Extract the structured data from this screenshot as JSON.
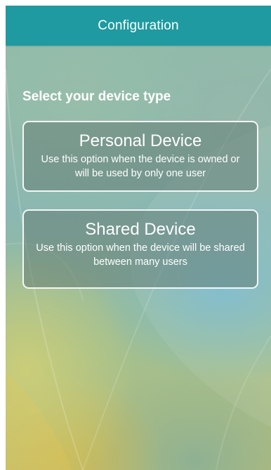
{
  "header": {
    "title": "Configuration"
  },
  "main": {
    "subtitle": "Select your device type",
    "options": [
      {
        "title": "Personal Device",
        "description": "Use this option when the device is owned or will be used by only one user"
      },
      {
        "title": "Shared Device",
        "description": "Use this option  when the device will be shared between many users"
      }
    ]
  },
  "colors": {
    "header_background": "#1e9aa0",
    "text": "#ffffff",
    "option_border": "#ffffff"
  }
}
